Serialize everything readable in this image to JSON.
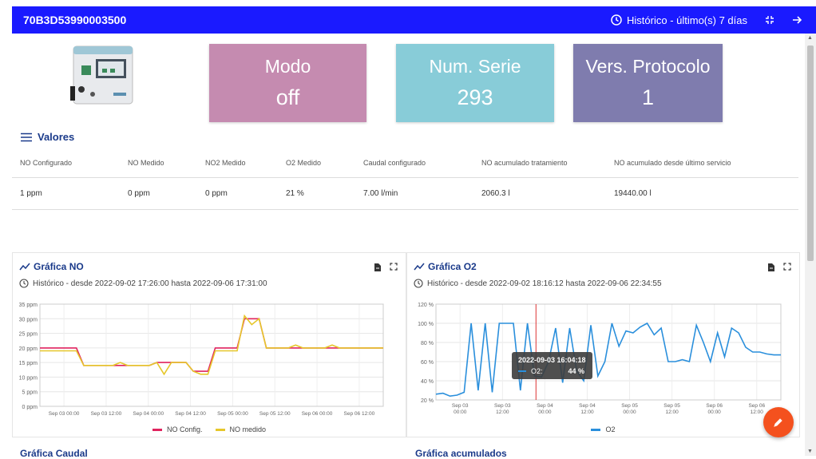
{
  "header": {
    "device_id": "70B3D53990003500",
    "history_label": "Histórico - último(s) 7 días"
  },
  "cards": [
    {
      "title": "Modo",
      "value": "off",
      "color": "#c58bb0"
    },
    {
      "title": "Num. Serie",
      "value": "293",
      "color": "#88ccd8"
    },
    {
      "title": "Vers. Protocolo",
      "value": "1",
      "color": "#7f7cae"
    }
  ],
  "valores": {
    "title": "Valores",
    "headers": [
      "NO Configurado",
      "NO Medido",
      "NO2 Medido",
      "O2 Medido",
      "Caudal configurado",
      "NO acumulado tratamiento",
      "NO acumulado desde último servicio"
    ],
    "row": [
      "1 ppm",
      "0 ppm",
      "0 ppm",
      "21 %",
      "7.00 l/min",
      "2060.3 l",
      "19440.00 l"
    ]
  },
  "panels": {
    "no": {
      "title": "Gráfica NO",
      "subtitle": "Histórico - desde 2022-09-02 17:26:00 hasta 2022-09-06 17:31:00"
    },
    "o2": {
      "title": "Gráfica O2",
      "subtitle": "Histórico - desde 2022-09-02 18:16:12 hasta 2022-09-06 22:34:55",
      "tooltip_date": "2022-09-03 16:04:18",
      "tooltip_series": "O2:",
      "tooltip_value": "44 %"
    },
    "caudal": {
      "title": "Gráfica Caudal"
    },
    "acum": {
      "title": "Gráfica acumulados"
    }
  },
  "chart_data": [
    {
      "type": "line",
      "title": "Gráfica NO",
      "y_ticks": [
        "0 ppm",
        "5 ppm",
        "10 ppm",
        "15 ppm",
        "20 ppm",
        "25 ppm",
        "30 ppm",
        "35 ppm"
      ],
      "ylim": [
        0,
        35
      ],
      "x_ticks": [
        "Sep 03 00:00",
        "Sep 03 12:00",
        "Sep 04 00:00",
        "Sep 04 12:00",
        "Sep 05 00:00",
        "Sep 05 12:00",
        "Sep 06 00:00",
        "Sep 06 12:00"
      ],
      "series": [
        {
          "name": "NO Config.",
          "color": "#e0245e",
          "values": [
            20,
            20,
            20,
            20,
            20,
            20,
            14,
            14,
            14,
            14,
            14,
            14,
            14,
            14,
            14,
            14,
            15,
            15,
            15,
            15,
            15,
            12,
            12,
            12,
            20,
            20,
            20,
            20,
            30,
            30,
            30,
            20,
            20,
            20,
            20,
            20,
            20,
            20,
            20,
            20,
            20,
            20,
            20,
            20,
            20,
            20,
            20,
            20
          ]
        },
        {
          "name": "NO medido",
          "color": "#e6c72b",
          "values": [
            19,
            19,
            19,
            19,
            19,
            19,
            14,
            14,
            14,
            14,
            14,
            15,
            14,
            14,
            14,
            14,
            15,
            11,
            15,
            15,
            15,
            12,
            11,
            11,
            19,
            19,
            19,
            19,
            31,
            28,
            30,
            20,
            20,
            20,
            20,
            21,
            20,
            20,
            20,
            20,
            21,
            20,
            20,
            20,
            20,
            20,
            20,
            20
          ]
        }
      ]
    },
    {
      "type": "line",
      "title": "Gráfica O2",
      "y_ticks": [
        "20 %",
        "40 %",
        "60 %",
        "80 %",
        "100 %",
        "120 %"
      ],
      "ylim": [
        20,
        120
      ],
      "x_ticks": [
        "Sep 03 00:00",
        "Sep 03 12:00",
        "Sep 04 00:00",
        "Sep 04 12:00",
        "Sep 05 00:00",
        "Sep 05 12:00",
        "Sep 06 00:00",
        "Sep 06 12:00"
      ],
      "series": [
        {
          "name": "O2",
          "color": "#2a8fdc",
          "values": [
            26,
            27,
            24,
            25,
            28,
            100,
            30,
            100,
            28,
            100,
            100,
            100,
            30,
            100,
            45,
            44,
            60,
            95,
            38,
            95,
            50,
            40,
            98,
            45,
            60,
            100,
            76,
            92,
            90,
            96,
            100,
            88,
            95,
            60,
            60,
            62,
            60,
            98,
            80,
            60,
            90,
            65,
            95,
            90,
            75,
            70,
            70,
            68,
            67,
            67
          ]
        }
      ]
    }
  ]
}
